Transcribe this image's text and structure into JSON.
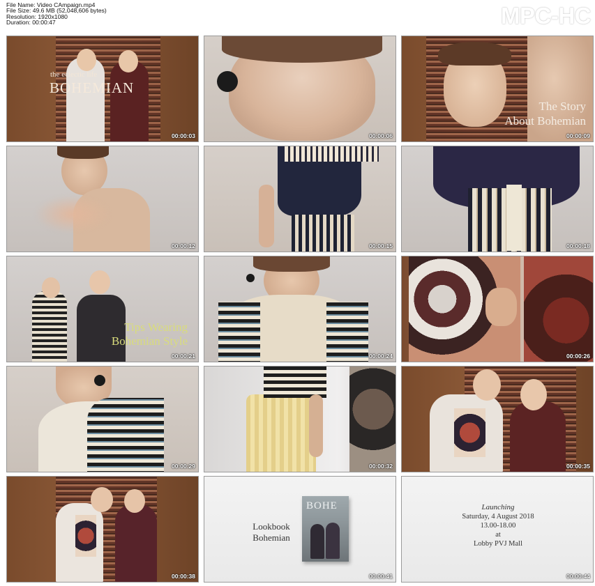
{
  "header": {
    "file_name": "File Name: Video CAmpaign.mp4",
    "file_size": "File Size: 49.6 MB (52,048,606 bytes)",
    "resolution": "Resolution: 1920x1080",
    "duration": "Duration: 00:00:47"
  },
  "brand": "MPC-HC",
  "thumbnails": [
    {
      "timestamp": "00:00:03",
      "caption_line1": "the eclectic life",
      "caption_line2": "BOHEMIAN"
    },
    {
      "timestamp": "00:00:06"
    },
    {
      "timestamp": "00:00:09",
      "caption_line1": "The Story",
      "caption_line2": "About Bohemian"
    },
    {
      "timestamp": "00:00:12"
    },
    {
      "timestamp": "00:00:15"
    },
    {
      "timestamp": "00:00:18"
    },
    {
      "timestamp": "00:00:21",
      "caption_line1": "Tips Wearing",
      "caption_line2": "Bohemian Style"
    },
    {
      "timestamp": "00:00:24"
    },
    {
      "timestamp": "00:00:26"
    },
    {
      "timestamp": "00:00:29"
    },
    {
      "timestamp": "00:00:32"
    },
    {
      "timestamp": "00:00:35"
    },
    {
      "timestamp": "00:00:38"
    },
    {
      "timestamp": "00:00:41",
      "caption_line1": "Lookbook",
      "caption_line2": "Bohemian",
      "cover_title": "BOHE"
    },
    {
      "timestamp": "00:00:44",
      "launch_title": "Launching",
      "launch_date": "Saturday, 4 August 2018",
      "launch_time": "13.00-18.00",
      "launch_at": "at",
      "launch_venue": "Lobby PVJ Mall"
    }
  ]
}
